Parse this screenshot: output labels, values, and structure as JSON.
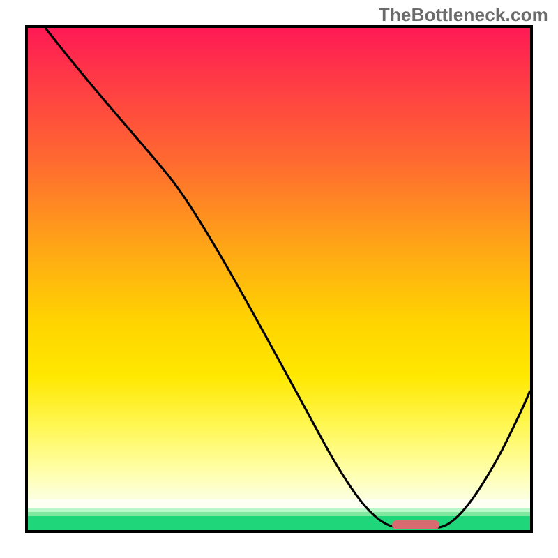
{
  "watermark": "TheBottleneck.com",
  "chart_data": {
    "type": "line",
    "title": "",
    "xlabel": "",
    "ylabel": "",
    "xlim": [
      0,
      100
    ],
    "ylim": [
      0,
      100
    ],
    "grid": false,
    "legend": false,
    "series": [
      {
        "name": "bottleneck-curve",
        "x": [
          3,
          10,
          18,
          25,
          28,
          35,
          45,
          55,
          60,
          68,
          73,
          78,
          82,
          88,
          94,
          100
        ],
        "values": [
          100,
          91,
          82,
          73,
          71,
          60,
          42,
          27,
          19,
          8,
          2,
          1,
          1,
          6,
          16,
          28
        ],
        "color": "#000000"
      }
    ],
    "optimal_range_x": [
      72,
      82
    ],
    "background_gradient_stops": [
      {
        "pos": 0.0,
        "color": "#ff1a55"
      },
      {
        "pos": 0.3,
        "color": "#ff6a30"
      },
      {
        "pos": 0.55,
        "color": "#ffd400"
      },
      {
        "pos": 0.8,
        "color": "#fff85a"
      },
      {
        "pos": 0.92,
        "color": "#ffffe5"
      },
      {
        "pos": 0.97,
        "color": "#8deaa8"
      },
      {
        "pos": 1.0,
        "color": "#1fd77a"
      }
    ],
    "optimal_marker_color": "#d86b6f"
  }
}
